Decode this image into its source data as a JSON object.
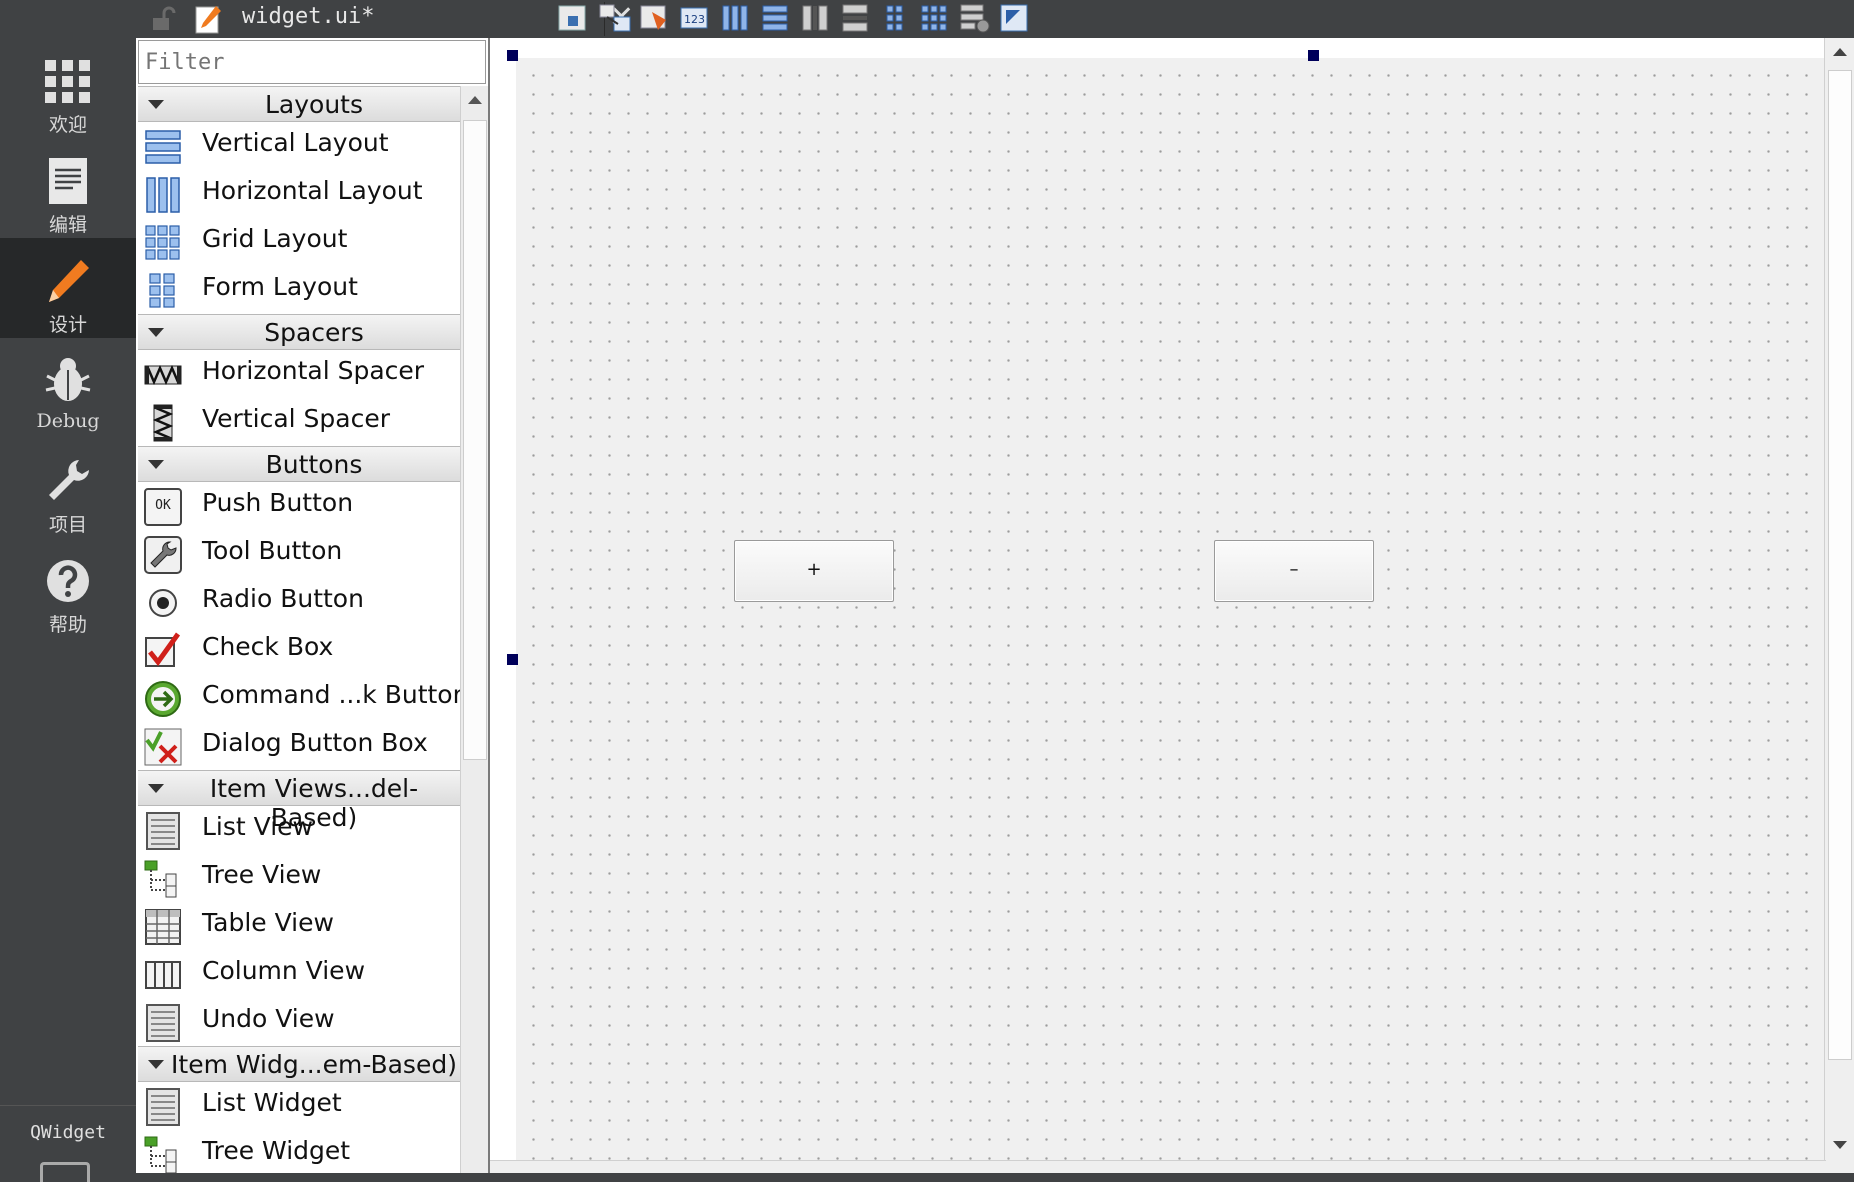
{
  "modes": [
    {
      "label": "欢迎",
      "icon": "grid-icon"
    },
    {
      "label": "编辑",
      "icon": "text-editor-icon"
    },
    {
      "label": "设计",
      "icon": "pencil-icon",
      "active": true
    },
    {
      "label": "Debug",
      "icon": "bug-icon"
    },
    {
      "label": "项目",
      "icon": "wrench-icon"
    },
    {
      "label": "帮助",
      "icon": "help-icon"
    }
  ],
  "mode_bottom_label": "QWidget",
  "toolbar": {
    "document_title": "widget.ui*",
    "close_symbol": "✕",
    "switch_up": "▲",
    "switch_down": "▼"
  },
  "widget_box": {
    "filter_placeholder": "Filter",
    "categories": [
      {
        "label": "Layouts",
        "items": [
          "Vertical Layout",
          "Horizontal Layout",
          "Grid Layout",
          "Form Layout"
        ]
      },
      {
        "label": "Spacers",
        "items": [
          "Horizontal Spacer",
          "Vertical Spacer"
        ]
      },
      {
        "label": "Buttons",
        "items": [
          "Push Button",
          "Tool Button",
          "Radio Button",
          "Check Box",
          "Command ...k Button",
          "Dialog Button Box"
        ]
      },
      {
        "label": "Item Views...del-Based)",
        "items": [
          "List View",
          "Tree View",
          "Table View",
          "Column View",
          "Undo View"
        ]
      },
      {
        "label": "Item Widg...em-Based)",
        "items": [
          "List Widget",
          "Tree Widget"
        ]
      }
    ],
    "push_button_icon_text": "OK"
  },
  "form": {
    "plus_button_label": "+",
    "minus_button_label": "–"
  },
  "colors": {
    "sidebar_bg": "#404244",
    "active_mode_bg": "#262829",
    "design_accent": "#f07b20",
    "handle": "#00005a"
  }
}
